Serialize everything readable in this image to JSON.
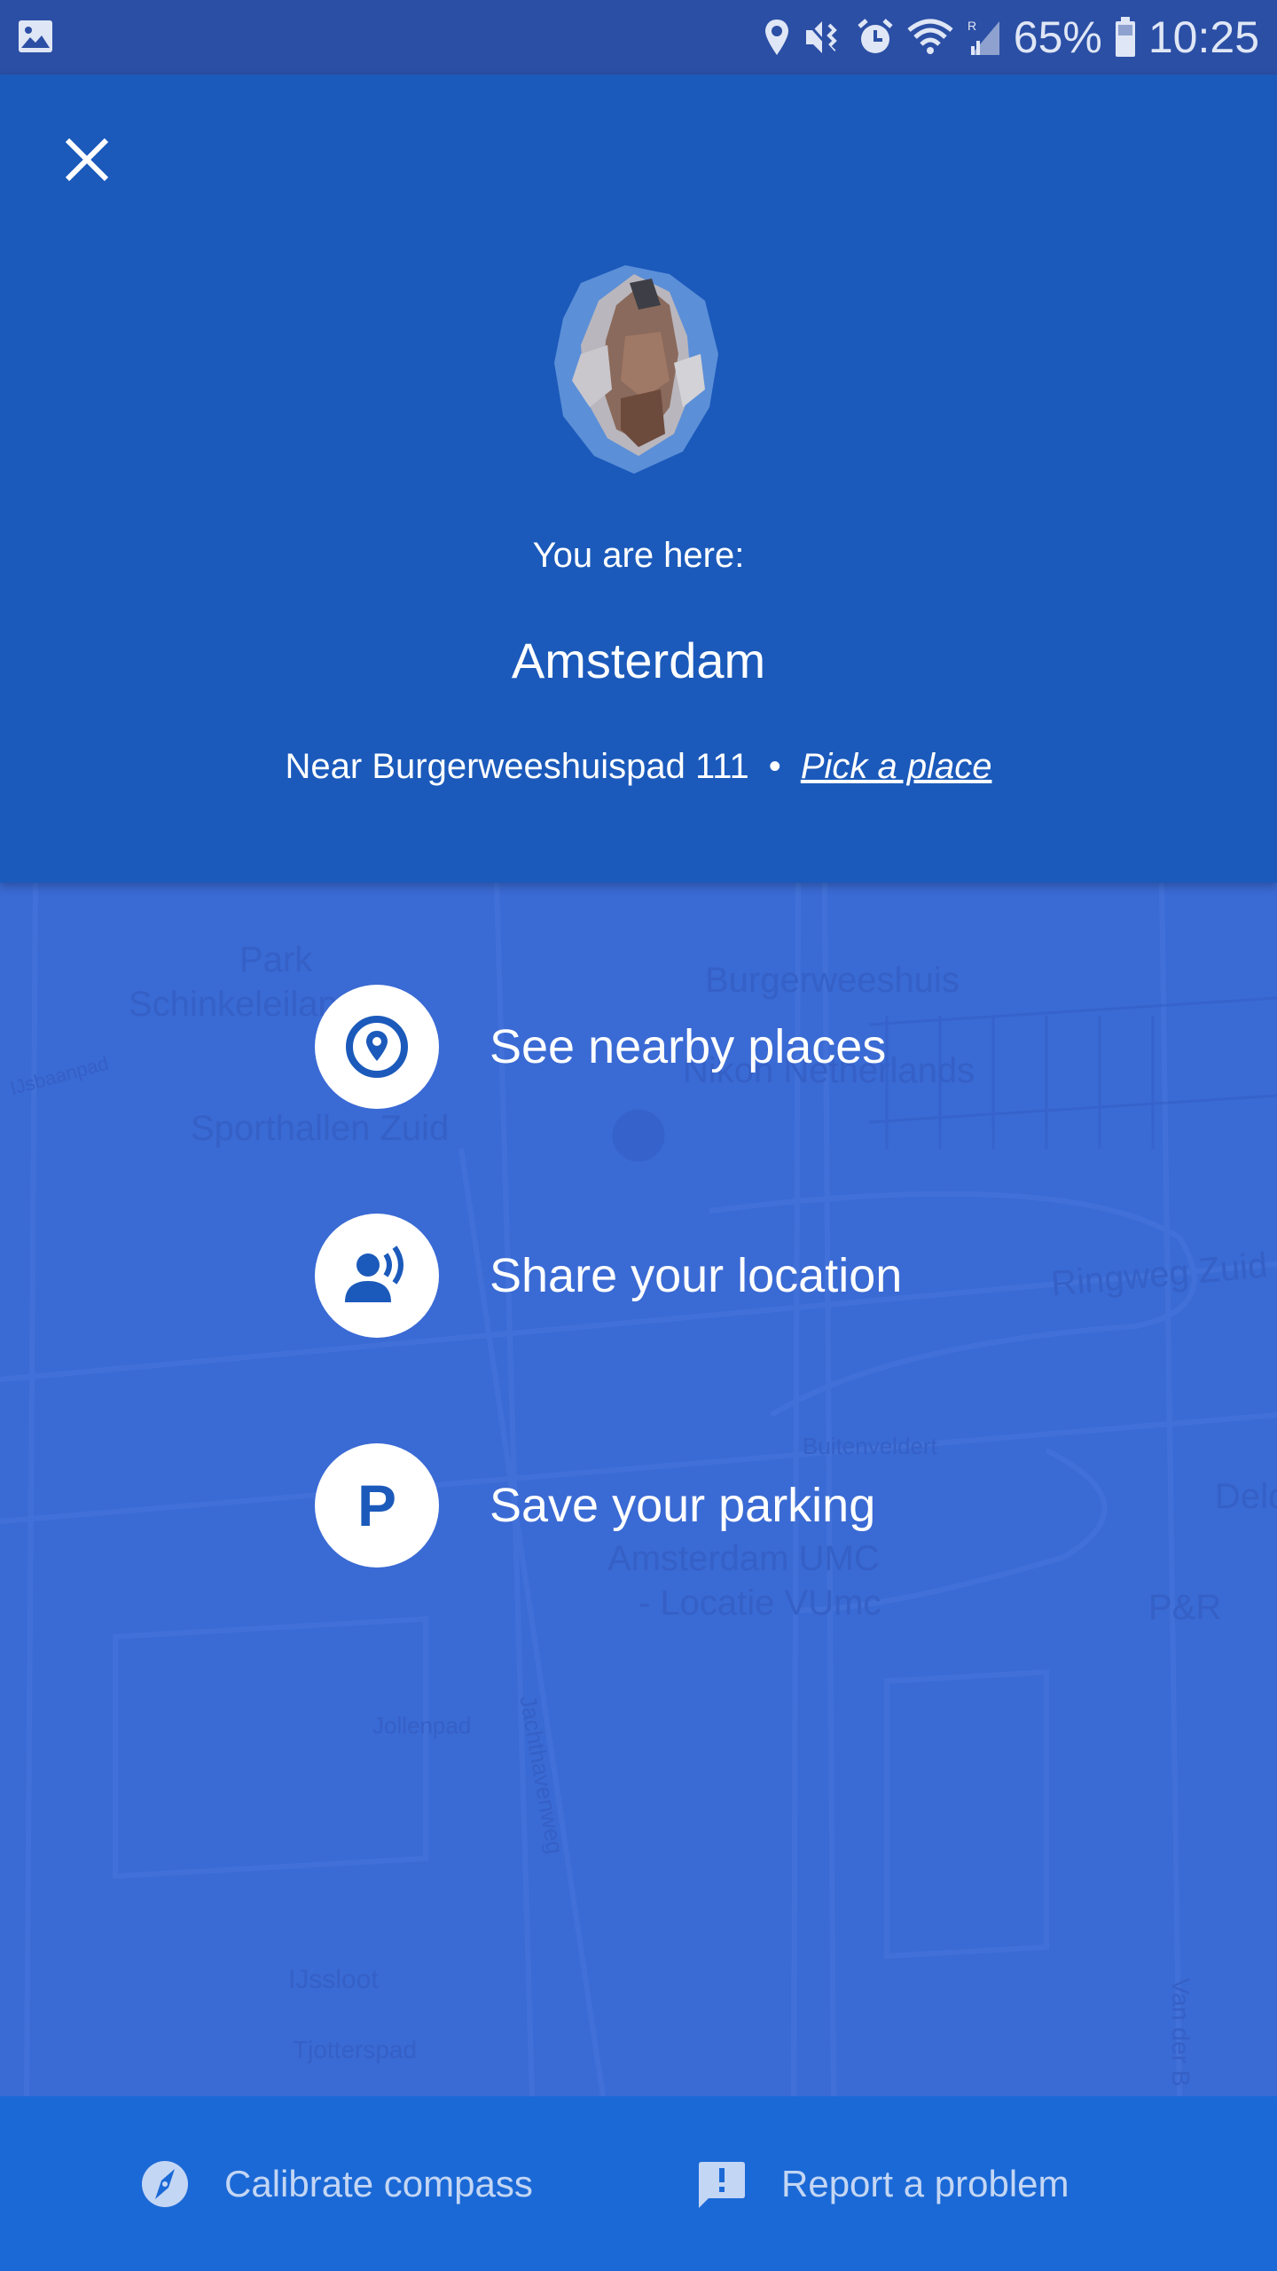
{
  "status_bar": {
    "left_icon": "image-notification-icon",
    "icons": [
      "location-icon",
      "mute-icon",
      "alarm-icon",
      "wifi-icon",
      "signal-roaming-icon"
    ],
    "battery_percent": "65%",
    "time": "10:25"
  },
  "header": {
    "close_icon": "close-icon",
    "avatar": "user-avatar-pixelated",
    "here_label": "You are here:",
    "city": "Amsterdam",
    "near_text": "Near Burgerweeshuispad 111",
    "separator": "•",
    "pick_place_link": "Pick a place"
  },
  "map_labels": {
    "park": "Park",
    "schinkeleilanden": "Schinkeleilanden",
    "burgerweeshuis": "Burgerweeshuis",
    "nikon": "Nikon Netherlands",
    "ijsbaanpad": "IJsbaanpad",
    "sporthallen": "Sporthallen Zuid",
    "ringweg": "Ringweg Zuid",
    "buitenveldert": "Buitenveldert",
    "delo": "Delo",
    "umc1": "Amsterdam UMC",
    "umc2": "- Locatie VUmc",
    "pr": "P&R",
    "jollenpad": "Jollenpad",
    "jachthavenweg": "Jachthavenweg",
    "ijssloot": "IJssloot",
    "tjotterspad": "Tjotterspad",
    "vanderb": "Van der B"
  },
  "actions": [
    {
      "label": "See nearby places",
      "icon": "nearby-places-icon"
    },
    {
      "label": "Share your location",
      "icon": "share-location-icon"
    },
    {
      "label": "Save your parking",
      "icon": "parking-icon",
      "glyph": "P"
    }
  ],
  "footer": {
    "calibrate_label": "Calibrate compass",
    "calibrate_icon": "compass-icon",
    "report_label": "Report a problem",
    "report_icon": "feedback-icon"
  },
  "colors": {
    "header_bg": "#1b5abb",
    "map_overlay": "#3a6ad4",
    "footer_bg": "#1b69d6",
    "icon_blue": "#1b5abb",
    "footer_text": "#c3d6f4"
  }
}
